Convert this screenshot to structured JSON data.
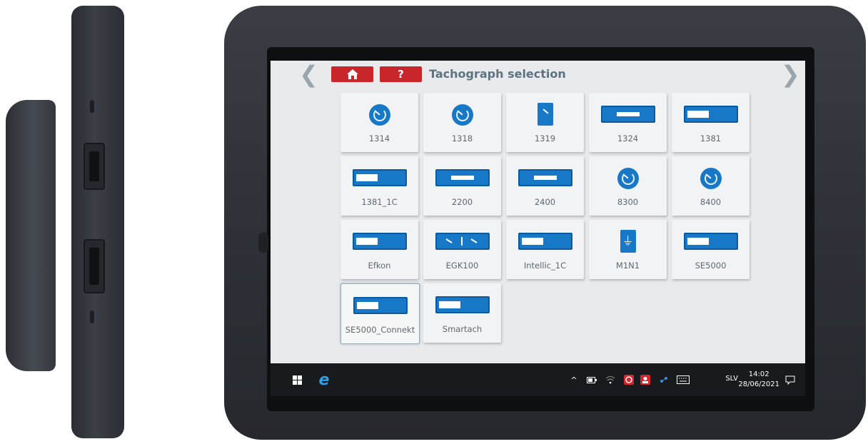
{
  "header": {
    "back_arrow": "❮",
    "forward_arrow": "❯",
    "home_icon": "home-icon",
    "help_label": "?",
    "title": "Tachograph selection"
  },
  "tachographs": [
    {
      "label": "1314",
      "icon": "round"
    },
    {
      "label": "1318",
      "icon": "round"
    },
    {
      "label": "1319",
      "icon": "tall"
    },
    {
      "label": "1324",
      "icon": "wide-center"
    },
    {
      "label": "1381",
      "icon": "wide-left"
    },
    {
      "label": "1381_1C",
      "icon": "wide-left"
    },
    {
      "label": "2200",
      "icon": "wide-center"
    },
    {
      "label": "2400",
      "icon": "wide-center"
    },
    {
      "label": "8300",
      "icon": "round"
    },
    {
      "label": "8400",
      "icon": "round"
    },
    {
      "label": "Efkon",
      "icon": "wide-left"
    },
    {
      "label": "EGK100",
      "icon": "egk"
    },
    {
      "label": "Intellic_1C",
      "icon": "wide-left"
    },
    {
      "label": "M1N1",
      "icon": "plug"
    },
    {
      "label": "SE5000",
      "icon": "wide-left"
    },
    {
      "label": "SE5000_Connekt",
      "icon": "wide-left",
      "selected": true
    },
    {
      "label": "Smartach",
      "icon": "wide-left"
    }
  ],
  "taskbar": {
    "language": "SLV",
    "time": "14:02",
    "date": "28/06/2021"
  },
  "colors": {
    "accent_red": "#c9262c",
    "icon_blue": "#1878c8",
    "title_text": "#5c7382"
  }
}
